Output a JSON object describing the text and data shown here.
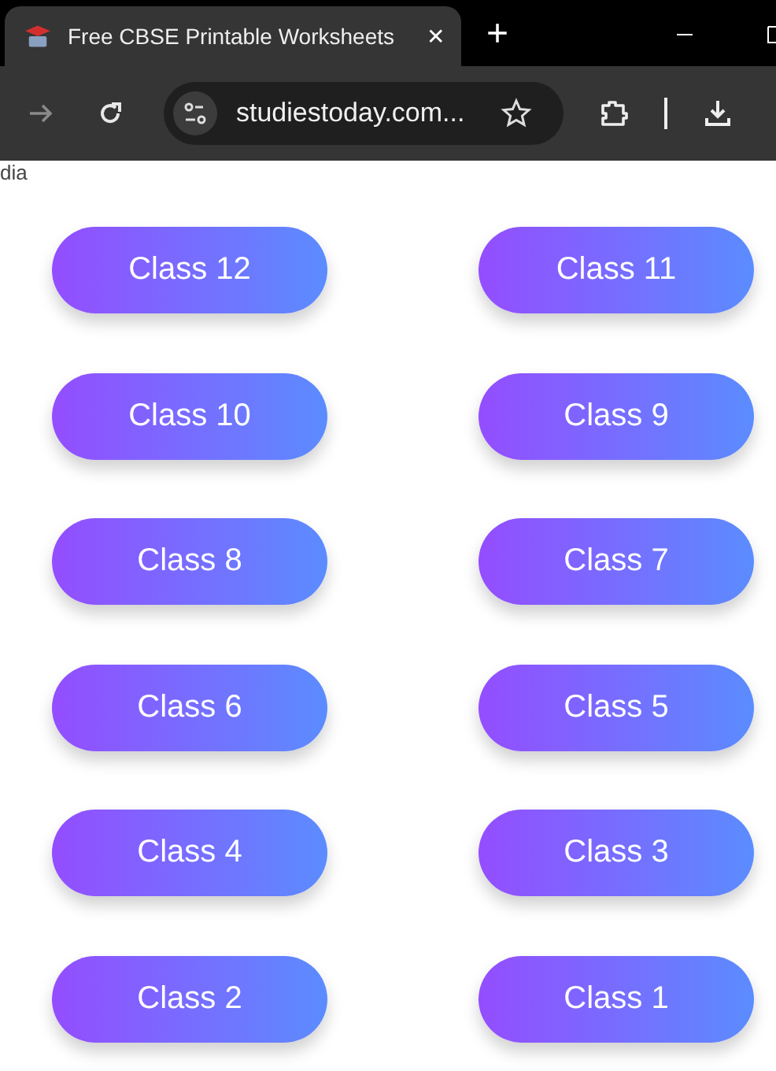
{
  "tab": {
    "title": "Free CBSE Printable Worksheets",
    "close": "✕"
  },
  "new_tab": "+",
  "address_bar": {
    "url": "studiestoday.com..."
  },
  "page": {
    "cut_text": "dia",
    "buttons": [
      {
        "label": "Class 12"
      },
      {
        "label": "Class 11"
      },
      {
        "label": "Class 10"
      },
      {
        "label": "Class 9"
      },
      {
        "label": "Class 8"
      },
      {
        "label": "Class 7"
      },
      {
        "label": "Class 6"
      },
      {
        "label": "Class 5"
      },
      {
        "label": "Class 4"
      },
      {
        "label": "Class 3"
      },
      {
        "label": "Class 2"
      },
      {
        "label": "Class 1"
      }
    ]
  }
}
